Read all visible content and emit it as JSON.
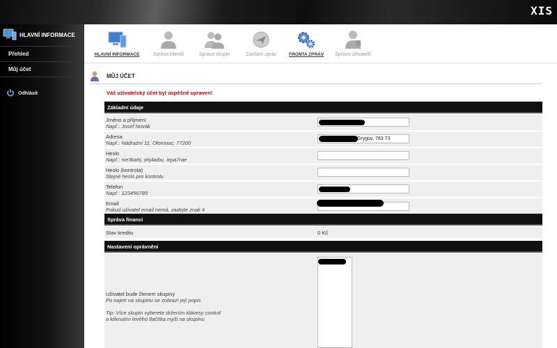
{
  "app": {
    "logo": "XIS"
  },
  "sidebar": {
    "header": "Hlavní informace",
    "items": [
      {
        "label": "Přehled"
      },
      {
        "label": "Můj účet"
      }
    ],
    "logout": "Odhlásit"
  },
  "nav": {
    "items": [
      {
        "label": "Hlavní informace",
        "icon": "computer-icon",
        "active": true
      },
      {
        "label": "Správa klientů",
        "icon": "user-icon",
        "active": false
      },
      {
        "label": "Správa skupin",
        "icon": "group-icon",
        "active": false
      },
      {
        "label": "Zasílání zpráv",
        "icon": "send-icon",
        "active": false
      },
      {
        "label": "Fronta zpráv",
        "icon": "gears-icon",
        "active": true
      },
      {
        "label": "Správa uživatelů",
        "icon": "users-admin-icon",
        "active": false
      }
    ]
  },
  "page": {
    "title": "Můj účet",
    "success_message": "Váš uživatelský účet byl úspěšně upraven!"
  },
  "sections": {
    "basic": "Základní údaje",
    "finance": "Správa financí",
    "permissions": "Nastavení oprávnění"
  },
  "form": {
    "name": {
      "label": "Jméno a příjmení",
      "hint": "Např.: Josef Novák",
      "value": ""
    },
    "address": {
      "label": "Adresa",
      "hint": "Např.: Nádražní 11, Olomouc, 77200",
      "value": "Grygov, 783 73"
    },
    "password": {
      "label": "Heslo",
      "hint": "Např.: nie3kahj, ohj4aibu, iepa7rae",
      "value": ""
    },
    "password_check": {
      "label": "Heslo (kontrola)",
      "hint": "Stejné heslo pro kontrolu",
      "value": ""
    },
    "phone": {
      "label": "Telefon",
      "hint": "Např.: 123456789",
      "value": ""
    },
    "email": {
      "label": "Email",
      "hint": "Pokud uživatel email nemá, zadejte znak #",
      "value": ""
    }
  },
  "finance": {
    "credit_label": "Stav kreditu",
    "credit_value": "0 Kč"
  },
  "permissions": {
    "group_label": "Uživatel bude členem skupiny",
    "group_hint": "Po najetí na skupinu se zobrazí její popis",
    "tip_line1": "Tip: Více skupin vyberete držením klávesy control",
    "tip_line2": "a kliknutím levého tlačítka myši na skupinu"
  },
  "colors": {
    "error": "#c40000",
    "section_bg": "#111111",
    "row_bg": "#efefef"
  }
}
